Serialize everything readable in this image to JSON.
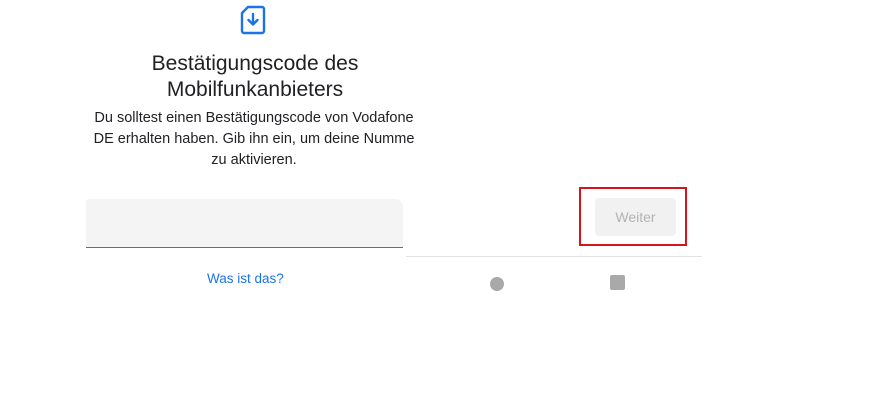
{
  "header": {
    "icon": "sim-download-icon",
    "title": "Bestätigungscode des Mobilfunkanbieters",
    "description": "Du solltest einen Bestätigungscode von Vodafone DE erhalten haben. Gib ihn ein, um deine Numme zu aktivieren."
  },
  "form": {
    "code_value": "",
    "help_link_label": "Was ist das?"
  },
  "actions": {
    "next_label": "Weiter"
  },
  "navigation_bar": {
    "home_icon": "circle-home-icon",
    "recents_icon": "square-recents-icon"
  },
  "colors": {
    "accent": "#1a73e8",
    "highlight": "#d4151b",
    "disabled_text": "#b3b3b3"
  }
}
